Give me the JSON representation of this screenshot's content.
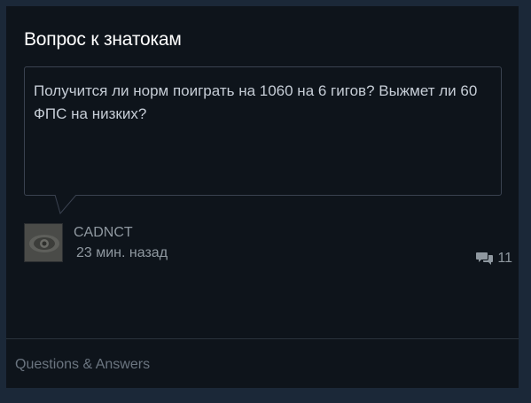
{
  "widget": {
    "title": "Вопрос к знатокам",
    "question_text": "Получится ли норм поиграть на 1060 на 6 гигов? Выжмет ли 60 ФПС на низких?",
    "author_name": "CADNCT",
    "time_ago": "23 мин. назад",
    "comment_count": "11",
    "footer_label": "Questions & Answers"
  },
  "icons": {
    "comments": "speech-bubbles-icon",
    "avatar": "eye-avatar-image"
  },
  "colors": {
    "background": "#1b2838",
    "card": "#0e141b",
    "title": "#ffffff",
    "muted_text": "#8f98a0"
  }
}
